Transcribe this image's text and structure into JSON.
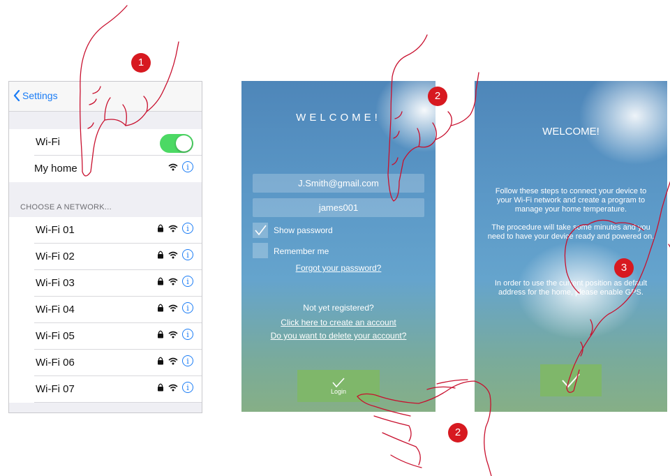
{
  "settings_screen": {
    "back_label": "Settings",
    "wifi_label": "Wi-Fi",
    "current_network": "My home",
    "section_header": "CHOOSE A NETWORK...",
    "networks": [
      "Wi-Fi 01",
      "Wi-Fi 02",
      "Wi-Fi 03",
      "Wi-Fi 04",
      "Wi-Fi 05",
      "Wi-Fi 06",
      "Wi-Fi 07"
    ],
    "info_glyph": "i",
    "toggle_state": "on",
    "accent_color": "#1a7cf5",
    "toggle_color": "#4cd964"
  },
  "login_screen": {
    "title": "WELCOME!",
    "email_value": "J.Smith@gmail.com",
    "password_value": "james001",
    "show_password_label": "Show password",
    "show_password_checked": true,
    "remember_me_label": "Remember me",
    "remember_me_checked": false,
    "forgot_link": "Forgot your password?",
    "not_registered": "Not yet registered?",
    "create_account_link": "Click here to create an account",
    "delete_account_link": "Do you want to delete your account?",
    "login_label": "Login",
    "button_color": "#7fb76a"
  },
  "welcome_screen": {
    "title": "WELCOME!",
    "paragraph_1": "Follow these steps to connect your device to your Wi-Fi network and create a program to manage your home temperature.",
    "paragraph_2": "The procedure will take some minutes and you need to have your device ready and powered on.",
    "paragraph_3": "In order to use the current position as default address for the home, please enable GPS."
  },
  "steps": {
    "step_1": "1",
    "step_2_top": "2",
    "step_2_bottom": "2",
    "step_3": "3",
    "badge_color": "#d71920"
  },
  "icons": [
    "chevron-left-icon",
    "wifi-icon",
    "lock-icon",
    "info-icon",
    "checkmark-icon",
    "pointing-hand-icon"
  ]
}
